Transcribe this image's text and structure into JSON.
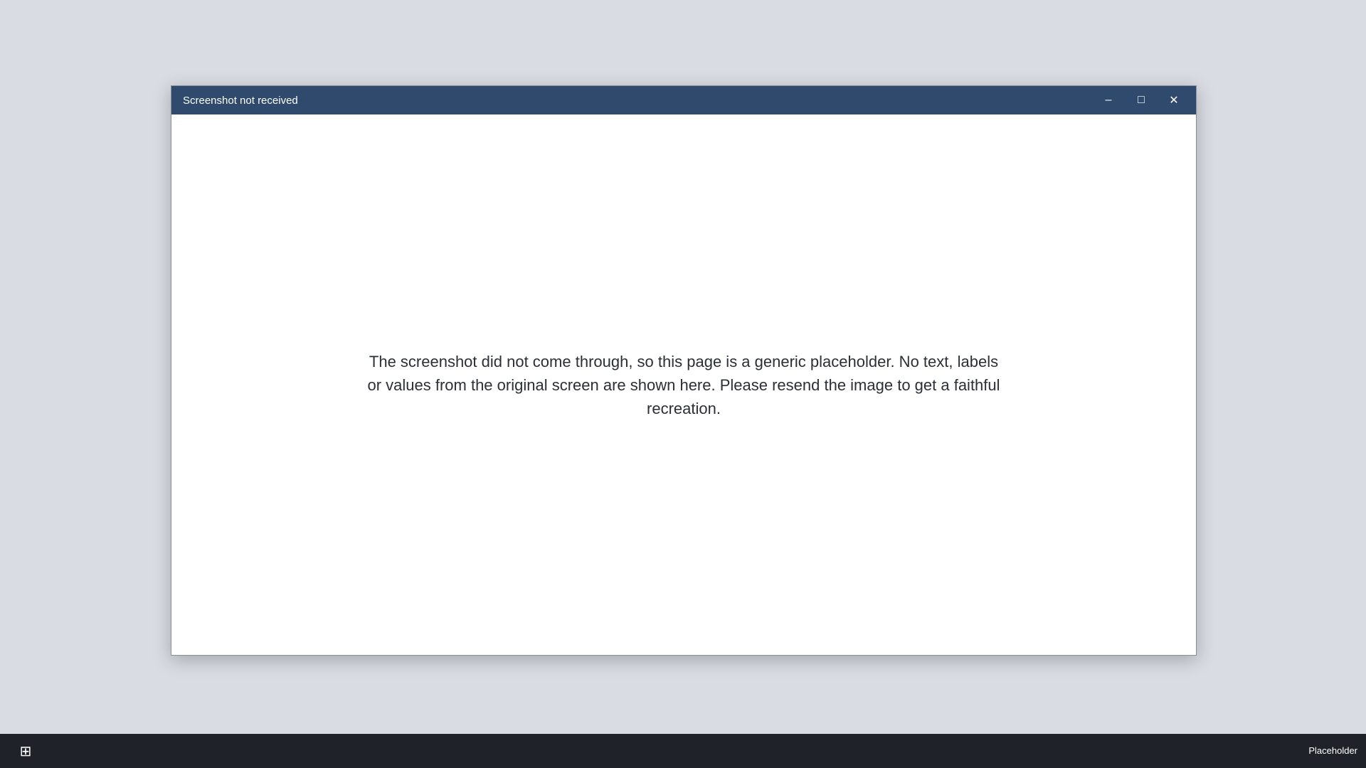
{
  "window": {
    "title": "Screenshot not received",
    "minimize_glyph": "–",
    "maximize_glyph": "□",
    "close_glyph": "✕"
  },
  "notice": {
    "text": "The screenshot did not come through, so this page is a generic placeholder. No text, labels or values from the original screen are shown here. Please resend the image to get a faithful recreation."
  },
  "taskbar": {
    "start_glyph": "⊞",
    "tray_text": "Placeholder"
  }
}
